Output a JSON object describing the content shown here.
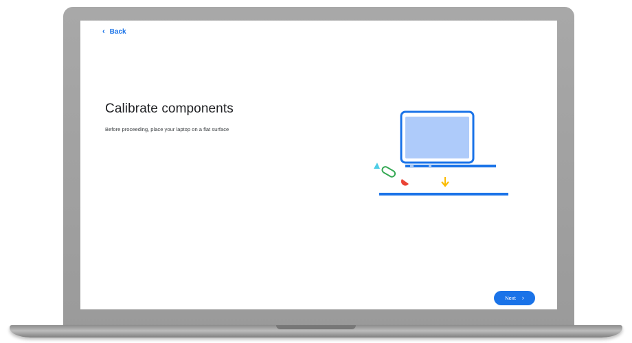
{
  "nav": {
    "back_label": "Back",
    "back_icon": "chevron-left-icon"
  },
  "main": {
    "title": "Calibrate components",
    "subtitle": "Before proceeding, place your laptop on a flat surface"
  },
  "footer": {
    "next_label": "Next",
    "next_icon": "chevron-right-icon"
  },
  "colors": {
    "accent": "#1a73e8",
    "laptop_screen": "#aecbfa",
    "green": "#34a853",
    "red": "#ea4335",
    "yellow": "#fbbc04",
    "teal": "#4ecde6"
  }
}
